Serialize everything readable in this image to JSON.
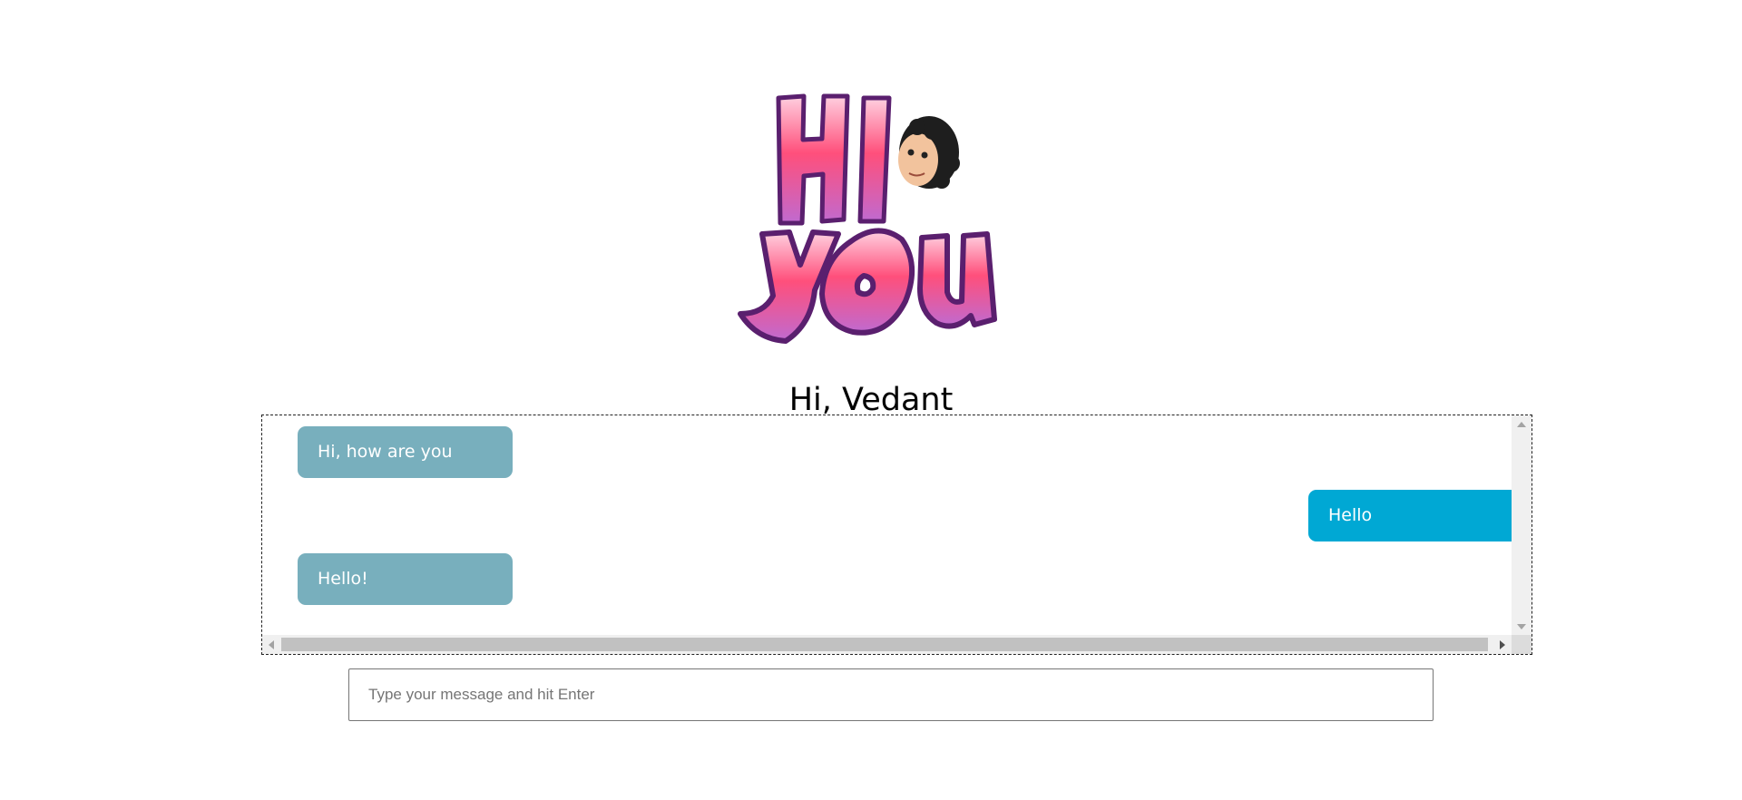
{
  "header": {
    "logo_text_top": "HI",
    "logo_text_bottom": "YOU",
    "greeting": "Hi, Vedant"
  },
  "chat": {
    "messages": [
      {
        "sender": "bot",
        "text": "Hi, how are you"
      },
      {
        "sender": "user",
        "text": "Hello"
      },
      {
        "sender": "bot",
        "text": "Hello!"
      }
    ]
  },
  "composer": {
    "value": "",
    "placeholder": "Type your message and hit Enter"
  },
  "colors": {
    "bot_bubble": "#78afbd",
    "user_bubble": "#00a8d4",
    "logo_pink": "#ff4f7b",
    "logo_purple": "#6b2c7e"
  },
  "icons": {
    "logo": "hi-you-avatar-logo",
    "scroll_up": "triangle-up",
    "scroll_down": "triangle-down",
    "scroll_left": "triangle-left",
    "scroll_right": "triangle-right"
  }
}
